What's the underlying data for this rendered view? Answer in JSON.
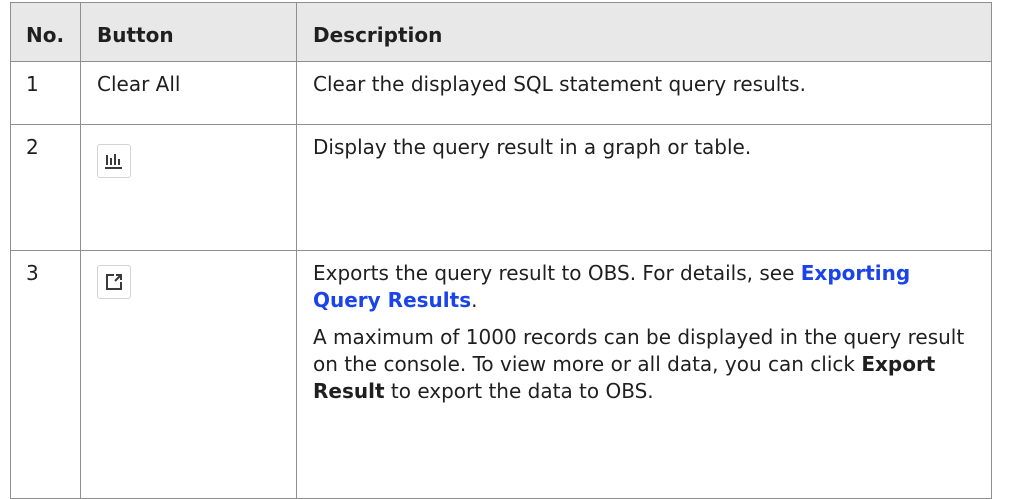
{
  "table": {
    "headers": {
      "no": "No.",
      "button": "Button",
      "description": "Description"
    },
    "rows": [
      {
        "no": "1",
        "button_text": "Clear All",
        "description": "Clear the displayed SQL statement query results."
      },
      {
        "no": "2",
        "button_icon": "bar-chart-icon",
        "description": "Display the query result in a graph or table."
      },
      {
        "no": "3",
        "button_icon": "export-icon",
        "description_p1_text": "Exports the query result to OBS. For details, see ",
        "description_p1_link": "Exporting Query Results",
        "description_p1_end": ".",
        "description_p2_before": "A maximum of 1000 records can be displayed in the query result on the console. To view more or all data, you can click ",
        "description_p2_bold": "Export Result",
        "description_p2_after": " to export the data to OBS."
      }
    ]
  },
  "colors": {
    "header_bg": "#e8e8e8",
    "border": "#8f8f8f",
    "link": "#1a44ea",
    "icon": "#3a3a3a"
  }
}
